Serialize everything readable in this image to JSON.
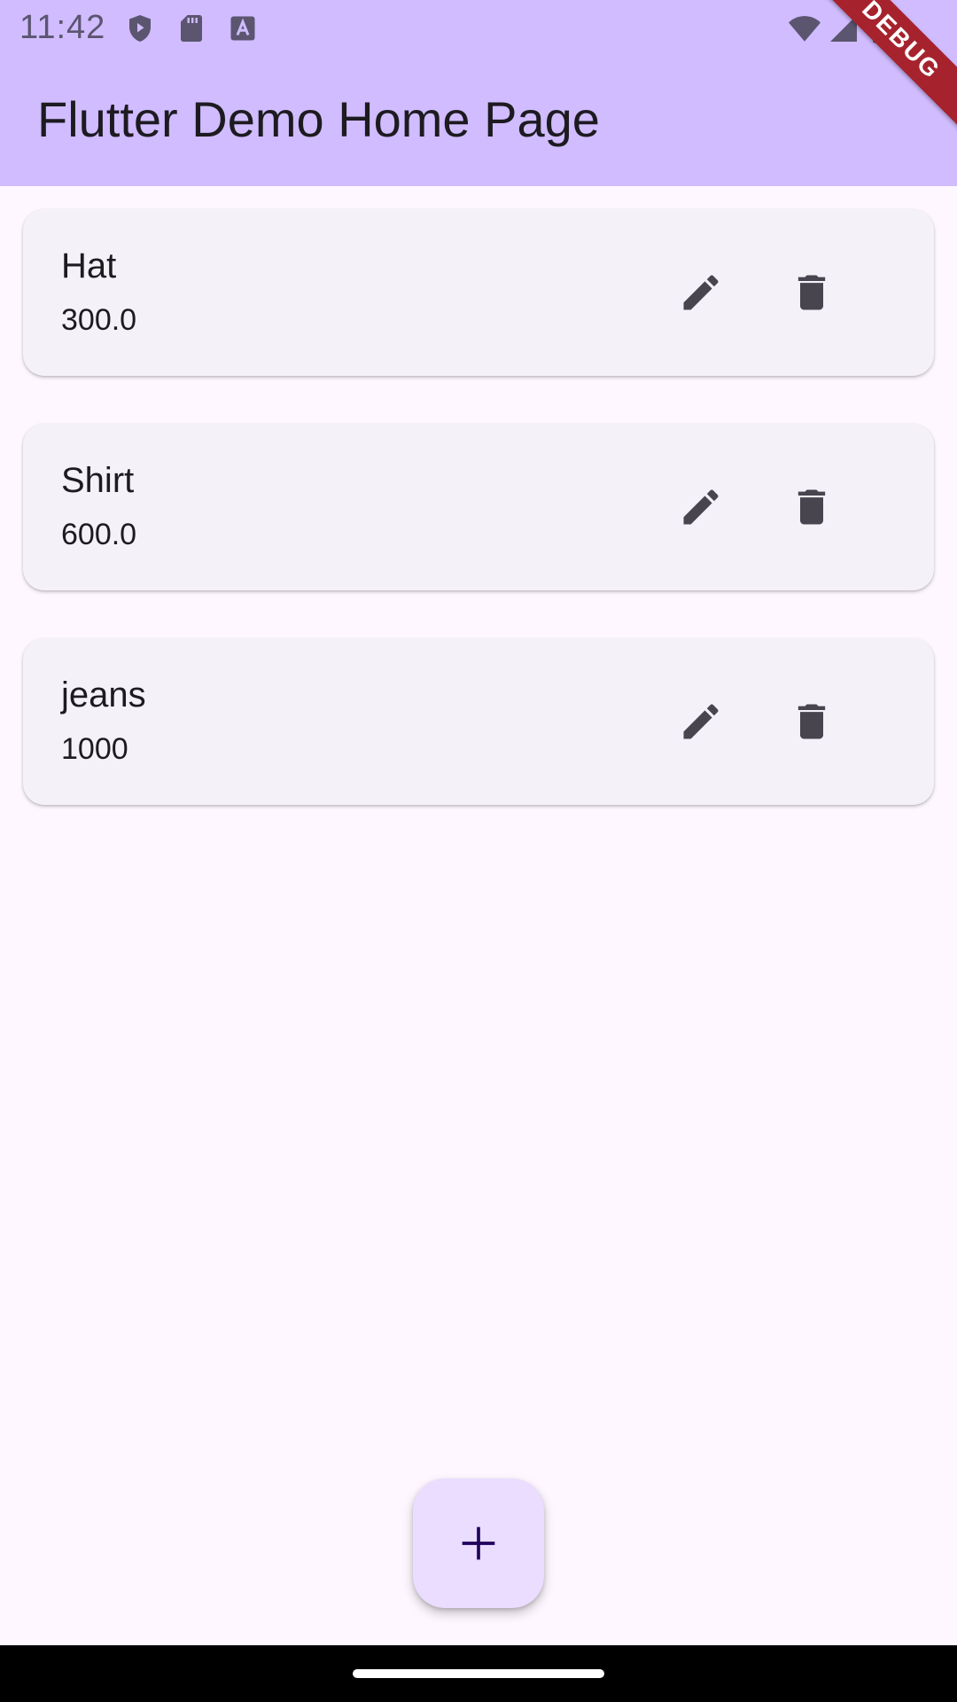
{
  "status_bar": {
    "time": "11:42"
  },
  "app_bar": {
    "title": "Flutter Demo Home Page",
    "debug_label": "DEBUG"
  },
  "items": [
    {
      "name": "Hat",
      "price": "300.0"
    },
    {
      "name": "Shirt",
      "price": "600.0"
    },
    {
      "name": "jeans",
      "price": "1000"
    }
  ],
  "icons": {
    "edit": "pencil-icon",
    "delete": "trash-icon",
    "add": "plus-icon"
  },
  "colors": {
    "app_bar": "#d0bcff",
    "background": "#fef7ff",
    "card": "#f5f1f8",
    "fab": "#eaddff",
    "icon": "#49454f",
    "debug": "#a6232e"
  }
}
